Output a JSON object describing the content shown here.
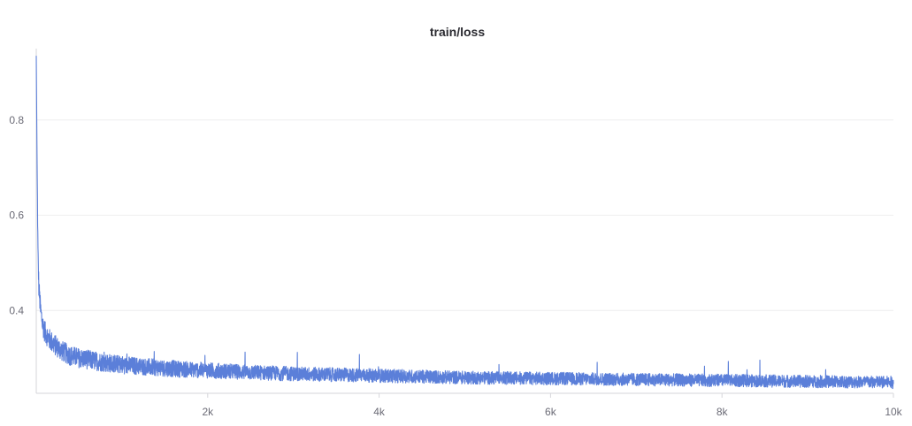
{
  "chart_data": {
    "type": "line",
    "title": "train/loss",
    "xlabel": "",
    "ylabel": "",
    "xlim": [
      0,
      10000
    ],
    "ylim": [
      0.226,
      0.95
    ],
    "x_ticks": [
      {
        "value": 2000,
        "label": "2k"
      },
      {
        "value": 4000,
        "label": "4k"
      },
      {
        "value": 6000,
        "label": "6k"
      },
      {
        "value": 8000,
        "label": "8k"
      },
      {
        "value": 10000,
        "label": "10k"
      }
    ],
    "y_ticks": [
      {
        "value": 0.4,
        "label": "0.4"
      },
      {
        "value": 0.6,
        "label": "0.6"
      },
      {
        "value": 0.8,
        "label": "0.8"
      }
    ],
    "grid": true,
    "series_color": "#5b7fd9",
    "series": [
      {
        "x": [
          0,
          10,
          20,
          30,
          50,
          75,
          100,
          150,
          200,
          300,
          400,
          500,
          750,
          1000,
          1250,
          1500,
          1750,
          2000,
          2500,
          3000,
          3500,
          4000,
          4500,
          5000,
          5500,
          6000,
          6500,
          7000,
          7500,
          8000,
          8500,
          9000,
          9500,
          10000
        ],
        "values": [
          0.935,
          0.7,
          0.52,
          0.45,
          0.4,
          0.37,
          0.355,
          0.34,
          0.33,
          0.315,
          0.305,
          0.3,
          0.292,
          0.286,
          0.282,
          0.279,
          0.276,
          0.274,
          0.27,
          0.267,
          0.265,
          0.263,
          0.261,
          0.259,
          0.258,
          0.257,
          0.256,
          0.255,
          0.254,
          0.253,
          0.252,
          0.251,
          0.25,
          0.249
        ]
      }
    ]
  }
}
